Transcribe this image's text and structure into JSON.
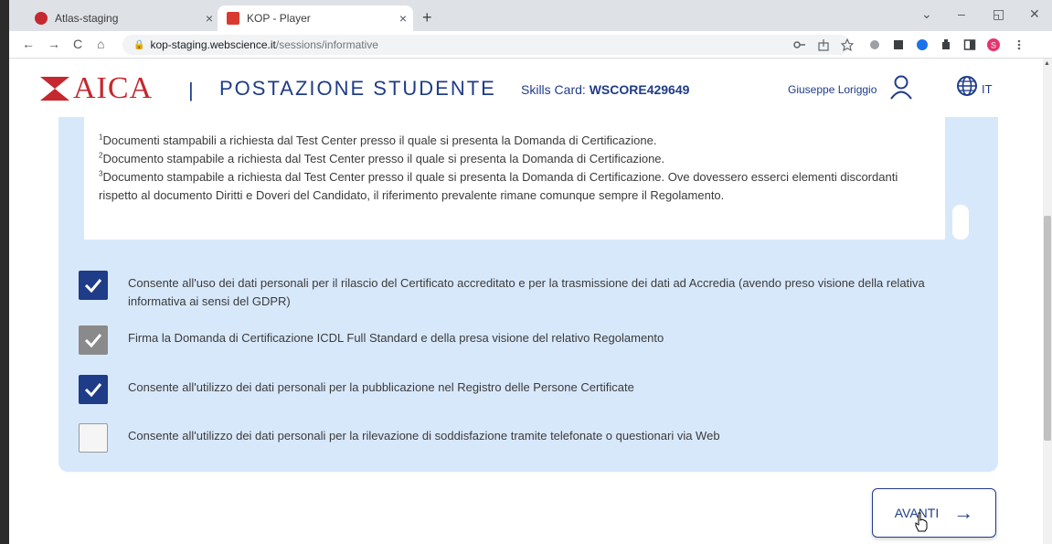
{
  "browser": {
    "tabs": [
      {
        "label": "Atlas-staging",
        "close": "×"
      },
      {
        "label": "KOP - Player",
        "close": "×"
      }
    ],
    "new_tab": "+",
    "window_controls": {
      "chevron": "⌄",
      "minimize": "–",
      "restore": "◱",
      "close": "✕"
    },
    "nav": {
      "back": "←",
      "forward": "→",
      "reload": "C",
      "home": "⌂"
    },
    "url_host": "kop-staging.webscience.it",
    "url_path": "/sessions/informative"
  },
  "header": {
    "logo_text": "AICA",
    "separator": "|",
    "title": "POSTAZIONE STUDENTE",
    "skills_label": "Skills Card: ",
    "skills_value": "WSCORE429649",
    "user_name": "Giuseppe Loriggio",
    "language": "IT"
  },
  "notes": [
    {
      "num": "1",
      "text": "Documenti stampabili a richiesta dal Test Center presso il quale si presenta la Domanda di Certificazione."
    },
    {
      "num": "2",
      "text": "Documento stampabile a richiesta dal Test Center presso il quale si presenta la Domanda di Certificazione."
    },
    {
      "num": "3",
      "text": "Documento stampabile a richiesta dal Test Center presso il quale si presenta la Domanda di Certificazione. Ove dovessero esserci elementi discordanti rispetto al documento Diritti e Doveri del Candidato, il riferimento prevalente rimane comunque sempre il Regolamento."
    }
  ],
  "consents": [
    {
      "text": "Consente all'uso dei dati personali per il rilascio del Certificato accreditato e per la trasmissione dei dati ad Accredia (avendo preso visione della relativa informativa ai sensi del GDPR)",
      "checked": true
    },
    {
      "text": "Firma la Domanda di Certificazione ICDL Full Standard e della presa visione del relativo Regolamento",
      "checked": true
    },
    {
      "text": "Consente all'utilizzo dei dati personali per la pubblicazione nel Registro delle Persone Certificate",
      "checked": true
    },
    {
      "text": "Consente all'utilizzo dei dati personali per la rilevazione di soddisfazione tramite telefonate o questionari via Web",
      "checked": false
    }
  ],
  "next_button": {
    "label": "AVANTI",
    "arrow": "→"
  },
  "colors": {
    "primary": "#1f3c88",
    "brand_red": "#c5282f",
    "panel": "#d8e8fb"
  }
}
